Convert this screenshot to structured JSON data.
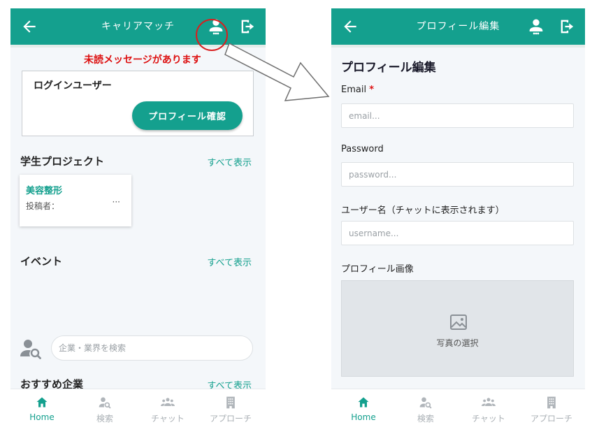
{
  "left": {
    "header_title": "キャリアマッチ",
    "notice": "未読メッセージがあります",
    "login_box": {
      "heading": "ログインユーザー",
      "button": "プロフィール確認"
    },
    "student_projects": {
      "heading": "学生プロジェクト",
      "link": "すべて表示",
      "card": {
        "title": "美容整形",
        "poster_label": "投稿者：",
        "more": "···"
      }
    },
    "events": {
      "heading": "イベント",
      "link": "すべて表示"
    },
    "search": {
      "placeholder": "企業・業界を検索"
    },
    "recommended": {
      "heading": "おすすめ企業",
      "link": "すべて表示"
    }
  },
  "right": {
    "header_title": "プロフィール編集",
    "form_title": "プロフィール編集",
    "email": {
      "label": "Email",
      "required_mark": "*",
      "placeholder": "email..."
    },
    "password": {
      "label": "Password",
      "placeholder": "password..."
    },
    "username": {
      "label": "ユーザー名（チャットに表示されます）",
      "placeholder": "username..."
    },
    "photo": {
      "label": "プロフィール画像",
      "select": "写真の選択"
    }
  },
  "tabs": [
    {
      "label": "Home",
      "icon": "home-icon",
      "active": true
    },
    {
      "label": "検索",
      "icon": "person-search-icon",
      "active": false
    },
    {
      "label": "チャット",
      "icon": "group-icon",
      "active": false
    },
    {
      "label": "アプローチ",
      "icon": "building-icon",
      "active": false
    }
  ],
  "colors": {
    "primary": "#14a08e",
    "alert": "#d11111",
    "annotation": "#d91e1e"
  }
}
